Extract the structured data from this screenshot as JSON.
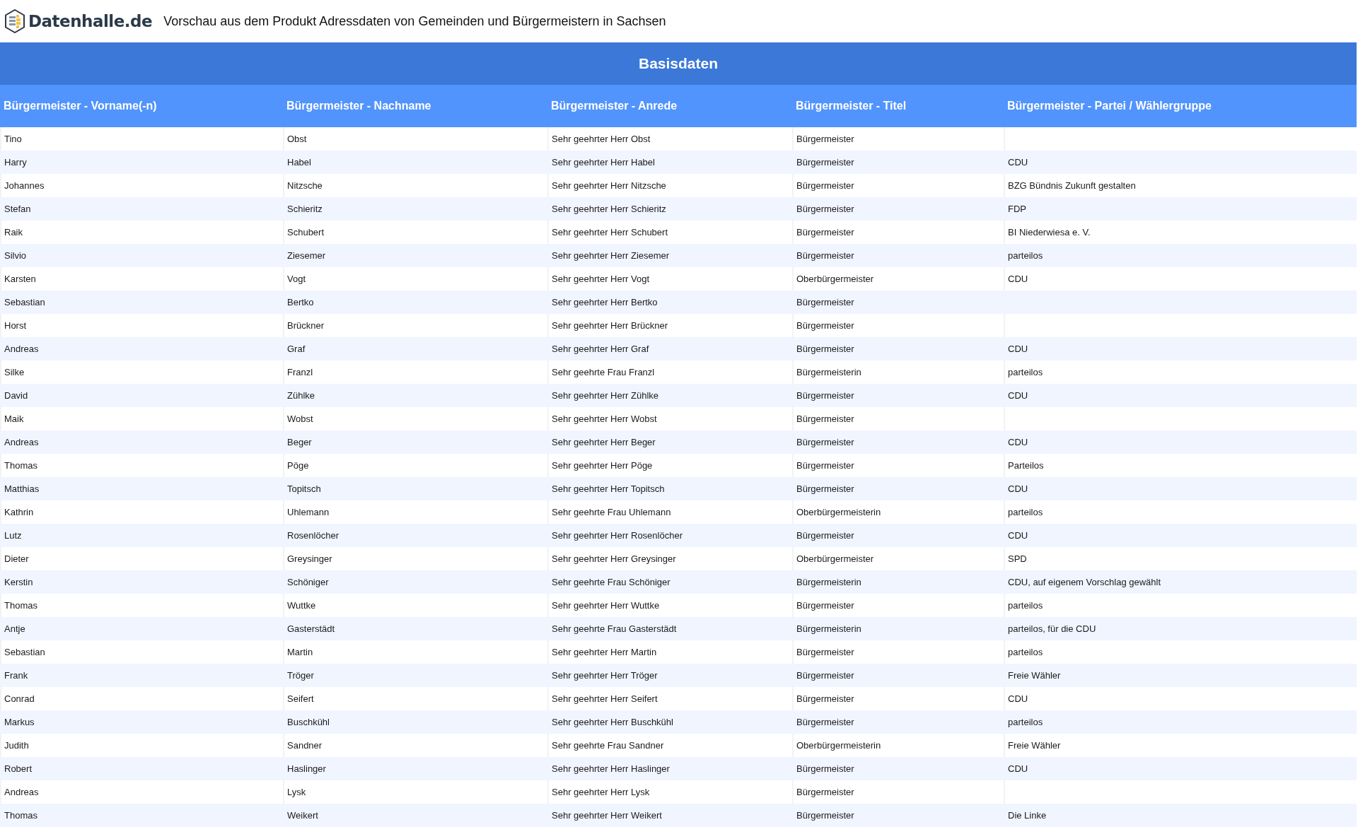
{
  "header": {
    "logo_text": "Datenhalle.de",
    "title": "Vorschau aus dem Produkt Adressdaten von Gemeinden und Bürgermeistern in Sachsen"
  },
  "section_title": "Basisdaten",
  "table": {
    "columns": [
      "Bürgermeister - Vorname(-n)",
      "Bürgermeister - Nachname",
      "Bürgermeister - Anrede",
      "Bürgermeister - Titel",
      "Bürgermeister - Partei / Wählergruppe"
    ],
    "rows": [
      [
        "Tino",
        "Obst",
        "Sehr geehrter Herr Obst",
        "Bürgermeister"
      ],
      [
        "Harry",
        "Habel",
        "Sehr geehrter Herr Habel",
        "Bürgermeister",
        "CDU"
      ],
      [
        "Johannes",
        "Nitzsche",
        "Sehr geehrter Herr Nitzsche",
        "Bürgermeister",
        "BZG Bündnis Zukunft gestalten"
      ],
      [
        "Stefan",
        "Schieritz",
        "Sehr geehrter Herr Schieritz",
        "Bürgermeister",
        "FDP"
      ],
      [
        "Raik",
        "Schubert",
        "Sehr geehrter Herr Schubert",
        "Bürgermeister",
        "BI Niederwiesa e. V."
      ],
      [
        "Silvio",
        "Ziesemer",
        "Sehr geehrter Herr Ziesemer",
        "Bürgermeister",
        "parteilos"
      ],
      [
        "Karsten",
        "Vogt",
        "Sehr geehrter Herr Vogt",
        "Oberbürgermeister",
        "CDU"
      ],
      [
        "Sebastian",
        "Bertko",
        "Sehr geehrter Herr Bertko",
        "Bürgermeister"
      ],
      [
        "Horst",
        "Brückner",
        "Sehr geehrter Herr Brückner",
        "Bürgermeister"
      ],
      [
        "Andreas",
        "Graf",
        "Sehr geehrter Herr Graf",
        "Bürgermeister",
        "CDU"
      ],
      [
        "Silke",
        "Franzl",
        "Sehr geehrte Frau Franzl",
        "Bürgermeisterin",
        "parteilos"
      ],
      [
        "David",
        "Zühlke",
        "Sehr geehrter Herr Zühlke",
        "Bürgermeister",
        "CDU"
      ],
      [
        "Maik",
        "Wobst",
        "Sehr geehrter Herr Wobst",
        "Bürgermeister"
      ],
      [
        "Andreas",
        "Beger",
        "Sehr geehrter Herr Beger",
        "Bürgermeister",
        "CDU"
      ],
      [
        "Thomas",
        "Pöge",
        "Sehr geehrter Herr Pöge",
        "Bürgermeister",
        "Parteilos"
      ],
      [
        "Matthias",
        "Topitsch",
        "Sehr geehrter Herr Topitsch",
        "Bürgermeister",
        "CDU"
      ],
      [
        "Kathrin",
        "Uhlemann",
        "Sehr geehrte Frau Uhlemann",
        "Oberbürgermeisterin",
        "parteilos"
      ],
      [
        "Lutz",
        "Rosenlöcher",
        "Sehr geehrter Herr Rosenlöcher",
        "Bürgermeister",
        "CDU"
      ],
      [
        "Dieter",
        "Greysinger",
        "Sehr geehrter Herr Greysinger",
        "Oberbürgermeister",
        "SPD"
      ],
      [
        "Kerstin",
        "Schöniger",
        "Sehr geehrte Frau Schöniger",
        "Bürgermeisterin",
        "CDU, auf eigenem Vorschlag gewählt"
      ],
      [
        "Thomas",
        "Wuttke",
        "Sehr geehrter Herr Wuttke",
        "Bürgermeister",
        "parteilos"
      ],
      [
        "Antje",
        "Gasterstädt",
        "Sehr geehrte Frau Gasterstädt",
        "Bürgermeisterin",
        "parteilos, für die CDU"
      ],
      [
        "Sebastian",
        "Martin",
        "Sehr geehrter Herr Martin",
        "Bürgermeister",
        "parteilos"
      ],
      [
        "Frank",
        "Tröger",
        "Sehr geehrter Herr Tröger",
        "Bürgermeister",
        "Freie Wähler"
      ],
      [
        "Conrad",
        "Seifert",
        "Sehr geehrter Herr Seifert",
        "Bürgermeister",
        "CDU"
      ],
      [
        "Markus",
        "Buschkühl",
        "Sehr geehrter Herr Buschkühl",
        "Bürgermeister",
        "parteilos"
      ],
      [
        "Judith",
        "Sandner",
        "Sehr geehrte Frau Sandner",
        "Oberbürgermeisterin",
        "Freie Wähler"
      ],
      [
        "Robert",
        "Haslinger",
        "Sehr geehrter Herr Haslinger",
        "Bürgermeister",
        "CDU"
      ],
      [
        "Andreas",
        "Lysk",
        "Sehr geehrter Herr Lysk",
        "Bürgermeister"
      ],
      [
        "Thomas",
        "Weikert",
        "Sehr geehrter Herr Weikert",
        "Bürgermeister",
        "Die Linke"
      ]
    ]
  }
}
